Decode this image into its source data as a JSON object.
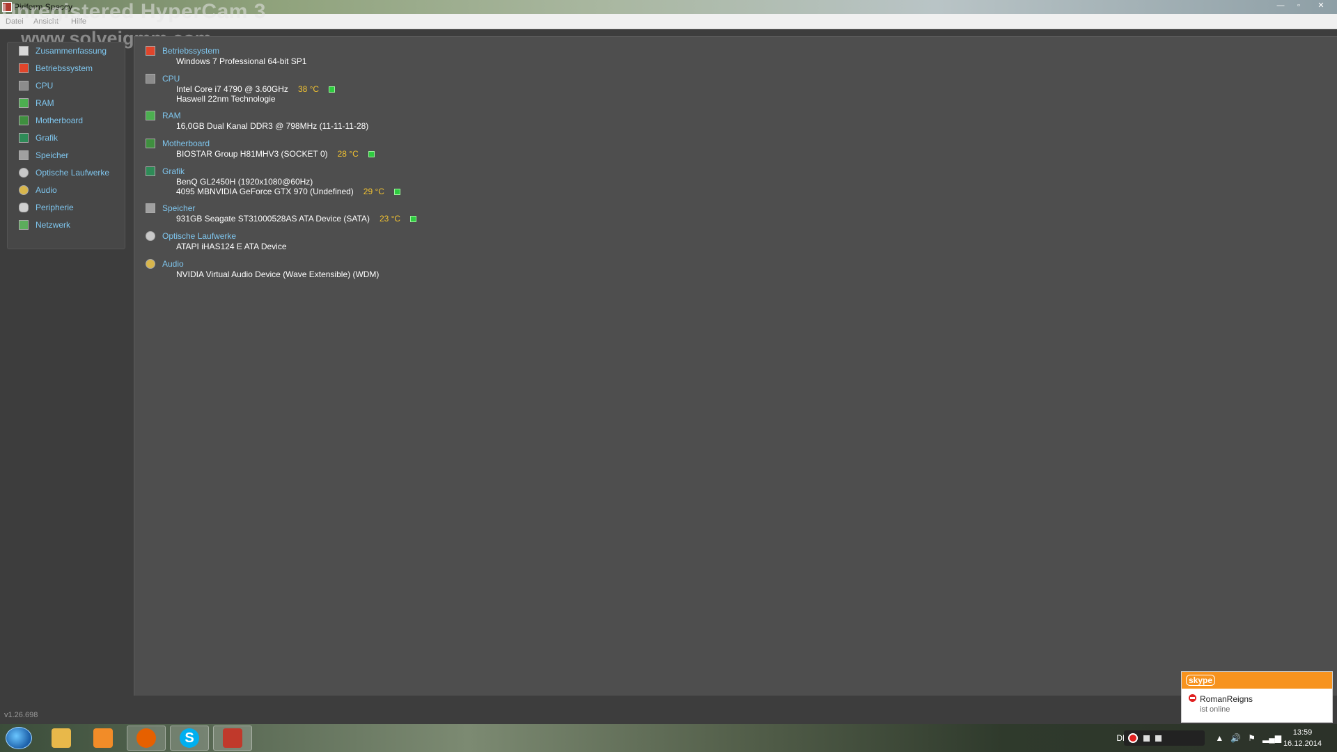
{
  "window": {
    "title": "Piriform Speccy",
    "watermark_primary": "Unregistered HyperCam 3",
    "watermark_secondary": "www.solveigmm.com",
    "controls": {
      "minimize": "—",
      "maximize": "▫",
      "close": "✕"
    }
  },
  "menu": [
    "Datei",
    "Ansicht",
    "Hilfe"
  ],
  "sidebar": {
    "items": [
      {
        "label": "Zusammenfassung",
        "icon": "summary-icon",
        "color": "#d9d9d9"
      },
      {
        "label": "Betriebssystem",
        "icon": "windows-icon",
        "color": "#e0452b"
      },
      {
        "label": "CPU",
        "icon": "cpu-icon",
        "color": "#8c8c8c"
      },
      {
        "label": "RAM",
        "icon": "ram-icon",
        "color": "#4caf50"
      },
      {
        "label": "Motherboard",
        "icon": "motherboard-icon",
        "color": "#3f8f3f"
      },
      {
        "label": "Grafik",
        "icon": "monitor-icon",
        "color": "#2e8b57"
      },
      {
        "label": "Speicher",
        "icon": "hdd-icon",
        "color": "#a0a0a0"
      },
      {
        "label": "Optische Laufwerke",
        "icon": "disc-icon",
        "color": "#c8c8c8"
      },
      {
        "label": "Audio",
        "icon": "speaker-icon",
        "color": "#d8b64c"
      },
      {
        "label": "Peripherie",
        "icon": "mouse-icon",
        "color": "#d0d0d0"
      },
      {
        "label": "Netzwerk",
        "icon": "network-icon",
        "color": "#5cad5c"
      }
    ]
  },
  "summary": {
    "sections": [
      {
        "title": "Betriebssystem",
        "icon": "windows-icon",
        "lines": [
          {
            "text": "Windows 7 Professional 64-bit SP1"
          }
        ]
      },
      {
        "title": "CPU",
        "icon": "cpu-icon",
        "lines": [
          {
            "text": "Intel Core i7 4790 @ 3.60GHz",
            "temp": "38 °C"
          },
          {
            "text": "Haswell 22nm Technologie"
          }
        ]
      },
      {
        "title": "RAM",
        "icon": "ram-icon",
        "lines": [
          {
            "text": "16,0GB Dual Kanal DDR3 @ 798MHz (11-11-11-28)"
          }
        ]
      },
      {
        "title": "Motherboard",
        "icon": "motherboard-icon",
        "lines": [
          {
            "text": "BIOSTAR Group H81MHV3 (SOCKET 0)",
            "temp": "28 °C"
          }
        ]
      },
      {
        "title": "Grafik",
        "icon": "monitor-icon",
        "lines": [
          {
            "text": "BenQ GL2450H (1920x1080@60Hz)"
          },
          {
            "text": "4095 MBNVIDIA GeForce GTX 970 (Undefined)",
            "temp": "29 °C"
          }
        ]
      },
      {
        "title": "Speicher",
        "icon": "hdd-icon",
        "lines": [
          {
            "text": "931GB Seagate ST31000528AS ATA Device (SATA)",
            "temp": "23 °C"
          }
        ]
      },
      {
        "title": "Optische Laufwerke",
        "icon": "disc-icon",
        "lines": [
          {
            "text": "ATAPI iHAS124 E ATA Device"
          }
        ]
      },
      {
        "title": "Audio",
        "icon": "speaker-icon",
        "lines": [
          {
            "text": "NVIDIA Virtual Audio Device (Wave Extensible) (WDM)"
          }
        ]
      }
    ]
  },
  "statusbar": {
    "version": "v1.26.698"
  },
  "taskbar": {
    "apps": [
      {
        "name": "explorer-icon",
        "color": "#e8b84a"
      },
      {
        "name": "media-player-icon",
        "color": "#f28c28"
      },
      {
        "name": "firefox-icon",
        "color": "#e66000"
      },
      {
        "name": "skype-icon",
        "color": "#00aff0",
        "glyph": "S"
      },
      {
        "name": "speccy-icon",
        "color": "#c0392b"
      }
    ],
    "language": "DE",
    "time": "13:59",
    "date": "16.12.2014"
  },
  "skype_popup": {
    "logo": "skype",
    "contact": "RomanReigns",
    "status_text": "ist online"
  }
}
